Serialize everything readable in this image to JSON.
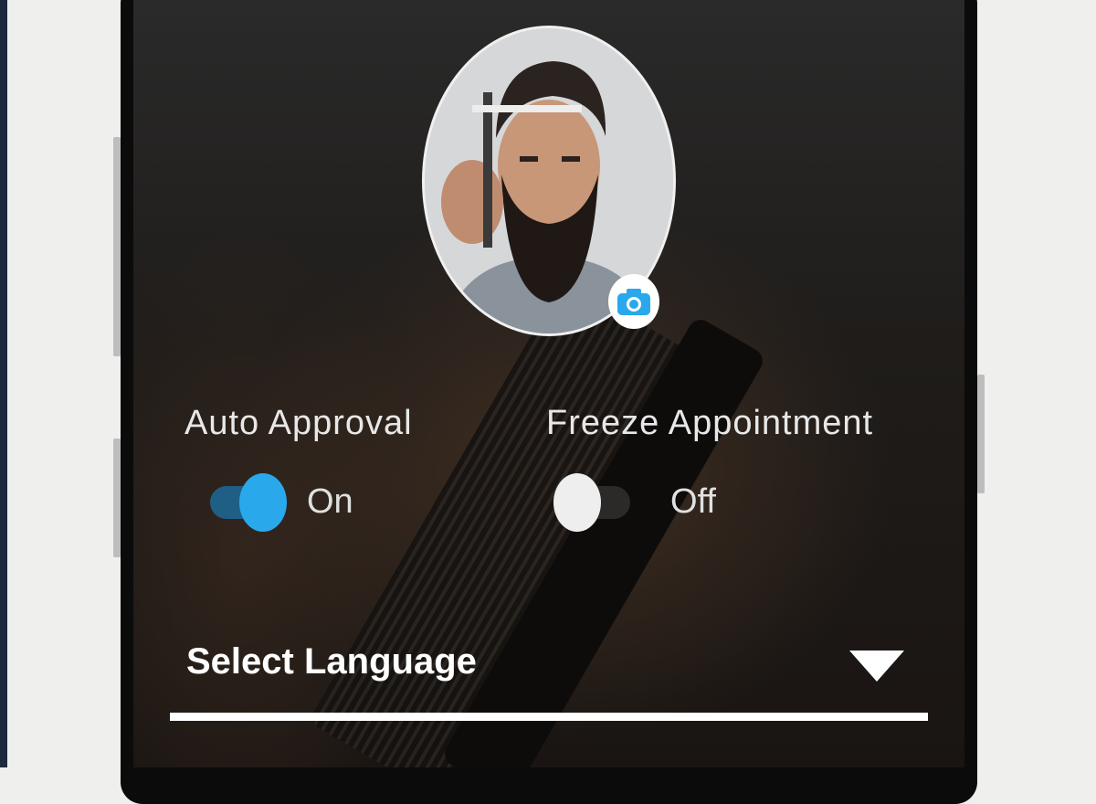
{
  "profile": {
    "avatar_alt": "Profile photo",
    "camera_icon": "camera-icon"
  },
  "settings": {
    "auto_approval": {
      "label": "Auto Approval",
      "state": "On",
      "enabled": true
    },
    "freeze_appointment": {
      "label": "Freeze Appointment",
      "state": "Off",
      "enabled": false
    }
  },
  "language": {
    "label": "Select Language",
    "icon": "dropdown-arrow-icon"
  },
  "colors": {
    "accent": "#29a8ec",
    "track_on": "#1f5f86",
    "thumb_off": "#eeeeee",
    "track_off": "#3a3a3a"
  }
}
